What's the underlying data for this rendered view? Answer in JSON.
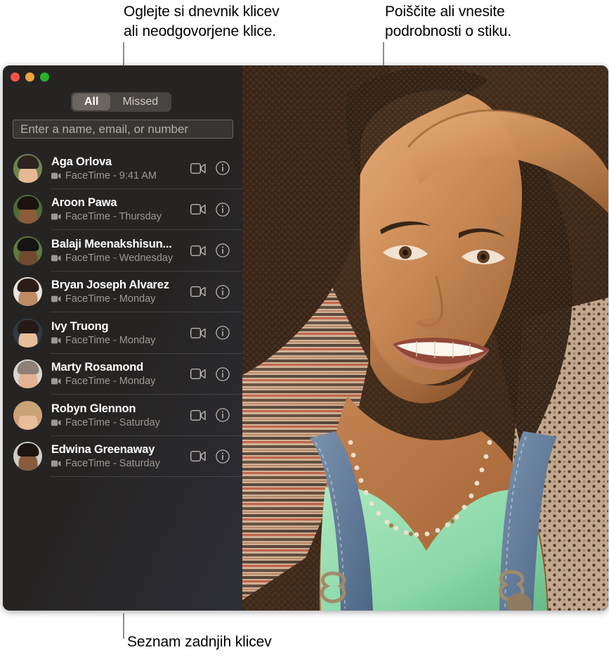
{
  "callouts": {
    "top_left": "Oglejte si dnevnik klicev\nali neodgovorjene klice.",
    "top_right": "Poiščite ali vnesite\npodrobnosti o stiku.",
    "bottom": "Seznam zadnjih klicev"
  },
  "window": {
    "traffic_lights": [
      {
        "name": "close",
        "color": "#F9524B"
      },
      {
        "name": "minimize",
        "color": "#F2A33C"
      },
      {
        "name": "zoom",
        "color": "#2BB12D"
      }
    ]
  },
  "sidebar": {
    "segmented_control": {
      "options": [
        "All",
        "Missed"
      ],
      "selected": "All"
    },
    "search": {
      "value": "",
      "placeholder": "Enter a name, email, or number"
    },
    "calls": [
      {
        "name": "Aga Orlova",
        "detail": "FaceTime - 9:41 AM",
        "avatar": {
          "bg": "#6f8551",
          "skin": "#e7b894",
          "hair": "#2e2320"
        }
      },
      {
        "name": "Aroon Pawa",
        "detail": "FaceTime - Thursday",
        "avatar": {
          "bg": "#4d6b34",
          "skin": "#8a5c3c",
          "hair": "#1b1310"
        }
      },
      {
        "name": "Balaji Meenakshisun...",
        "detail": "FaceTime - Wednesday",
        "avatar": {
          "bg": "#5d7a3f",
          "skin": "#6f4a31",
          "hair": "#141414"
        }
      },
      {
        "name": "Bryan Joseph Alvarez",
        "detail": "FaceTime - Monday",
        "avatar": {
          "bg": "#e8e4de",
          "skin": "#c08a62",
          "hair": "#2b1d16"
        }
      },
      {
        "name": "Ivy Truong",
        "detail": "FaceTime - Monday",
        "avatar": {
          "bg": "#2f3a46",
          "skin": "#e8bd9c",
          "hair": "#241a16"
        }
      },
      {
        "name": "Marty Rosamond",
        "detail": "FaceTime - Monday",
        "avatar": {
          "bg": "#d9d6d1",
          "skin": "#e2b294",
          "hair": "#8d8178"
        }
      },
      {
        "name": "Robyn Glennon",
        "detail": "FaceTime - Saturday",
        "avatar": {
          "bg": "#cfa17a",
          "skin": "#e7bd9a",
          "hair": "#c8a374"
        }
      },
      {
        "name": "Edwina Greenaway",
        "detail": "FaceTime - Saturday",
        "avatar": {
          "bg": "#cbcdc6",
          "skin": "#8a5a3c",
          "hair": "#1d1512"
        }
      }
    ],
    "row_icons": {
      "video_call": "video-camera-icon",
      "info": "info-circle-icon",
      "call_type": "video-camera-small-icon"
    }
  },
  "video_pane": {
    "name": "facetime-video-feed",
    "colors": {
      "hair": "#3c2b1e",
      "skin": "#c98d5d",
      "shirt": "#8fe0b4",
      "denim": "#5d7fa0",
      "blanket": "#c9a78b"
    }
  }
}
